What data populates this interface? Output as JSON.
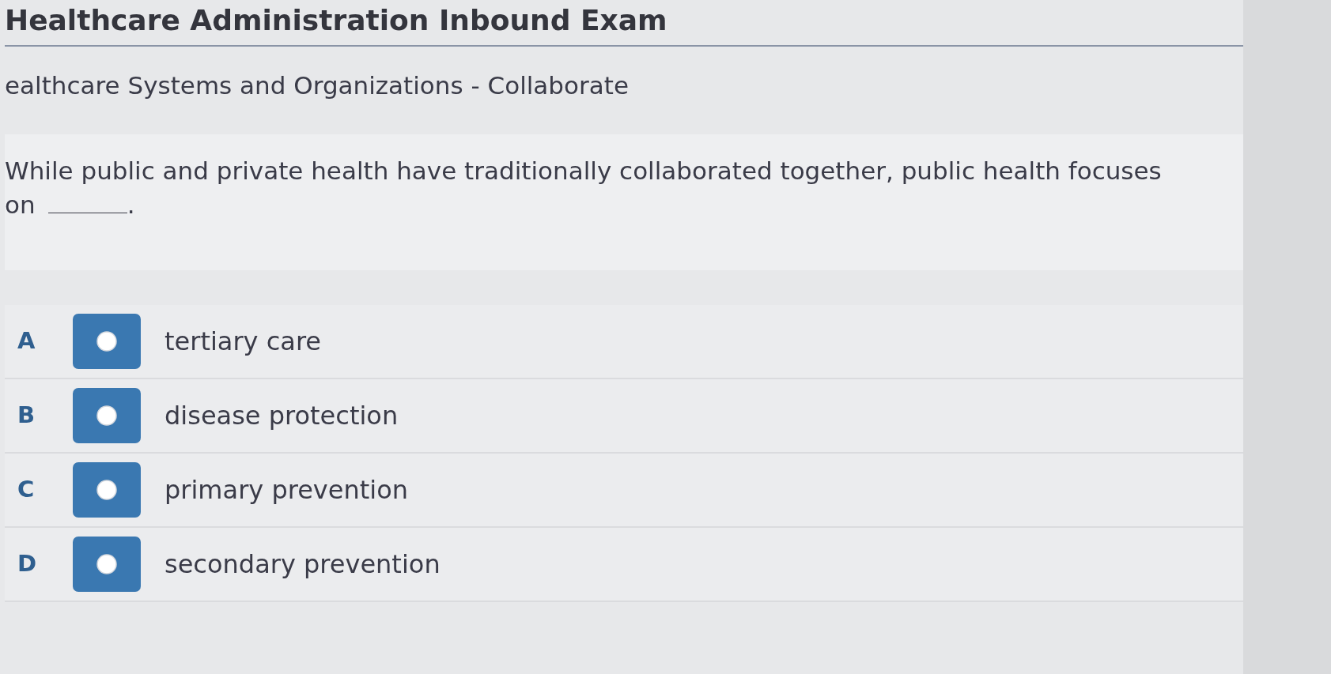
{
  "exam": {
    "title": "Healthcare Administration Inbound Exam",
    "section": "ealthcare Systems and Organizations - Collaborate"
  },
  "question": {
    "lines": [
      "While public and private health have traditionally collaborated together, public health focuses",
      "on"
    ],
    "end": "."
  },
  "options": [
    {
      "letter": "A",
      "label": "tertiary care",
      "selected": false
    },
    {
      "letter": "B",
      "label": "disease protection",
      "selected": false
    },
    {
      "letter": "C",
      "label": "primary prevention",
      "selected": false
    },
    {
      "letter": "D",
      "label": "secondary prevention",
      "selected": false
    }
  ]
}
